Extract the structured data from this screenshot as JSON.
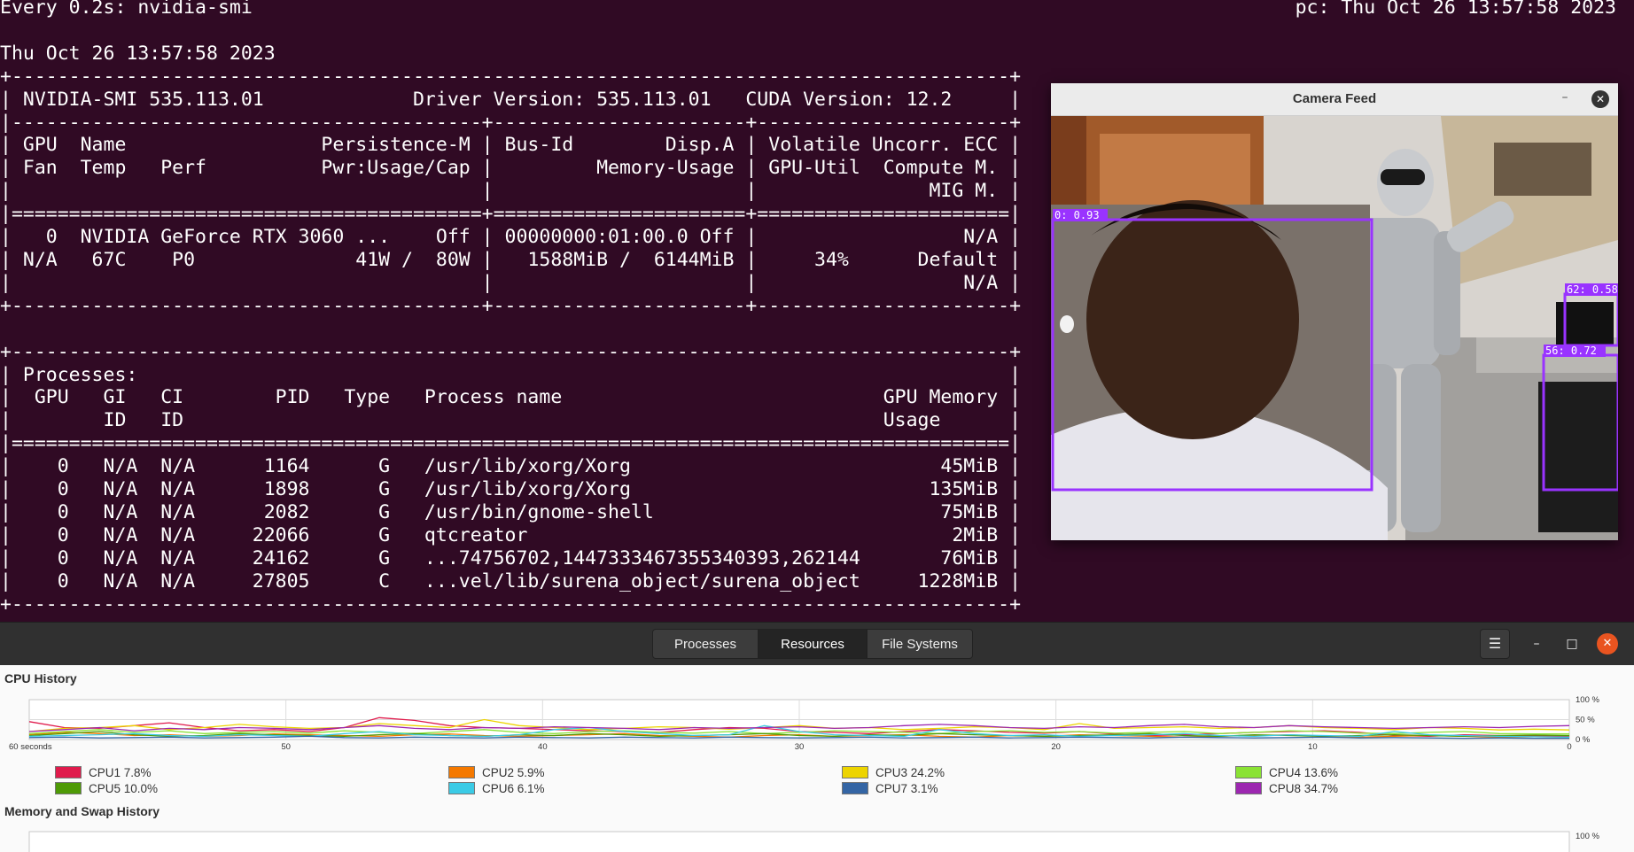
{
  "terminal": {
    "header_left": "Every 0.2s: nvidia-smi",
    "header_right": "pc: Thu Oct 26 13:57:58 2023",
    "lines": [
      "",
      "Thu Oct 26 13:57:58 2023",
      "+---------------------------------------------------------------------------------------+",
      "| NVIDIA-SMI 535.113.01             Driver Version: 535.113.01   CUDA Version: 12.2     |",
      "|-----------------------------------------+----------------------+----------------------+",
      "| GPU  Name                 Persistence-M | Bus-Id        Disp.A | Volatile Uncorr. ECC |",
      "| Fan  Temp   Perf          Pwr:Usage/Cap |         Memory-Usage | GPU-Util  Compute M. |",
      "|                                         |                      |               MIG M. |",
      "|=========================================+======================+======================|",
      "|   0  NVIDIA GeForce RTX 3060 ...    Off | 00000000:01:00.0 Off |                  N/A |",
      "| N/A   67C    P0              41W /  80W |   1588MiB /  6144MiB |     34%      Default |",
      "|                                         |                      |                  N/A |",
      "+-----------------------------------------+----------------------+----------------------+",
      "",
      "+---------------------------------------------------------------------------------------+",
      "| Processes:                                                                            |",
      "|  GPU   GI   CI        PID   Type   Process name                            GPU Memory |",
      "|        ID   ID                                                             Usage      |",
      "|=======================================================================================|",
      "|    0   N/A  N/A      1164      G   /usr/lib/xorg/Xorg                           45MiB |",
      "|    0   N/A  N/A      1898      G   /usr/lib/xorg/Xorg                          135MiB |",
      "|    0   N/A  N/A      2082      G   /usr/bin/gnome-shell                         75MiB |",
      "|    0   N/A  N/A     22066      G   qtcreator                                     2MiB |",
      "|    0   N/A  N/A     24162      G   ...74756702,1447333467355340393,262144       76MiB |",
      "|    0   N/A  N/A     27805      C   ...vel/lib/surena_object/surena_object     1228MiB |",
      "+---------------------------------------------------------------------------------------+"
    ]
  },
  "camera": {
    "title": "Camera Feed",
    "minimize_glyph": "–",
    "close_glyph": "✕",
    "detections": [
      "0: 0.93",
      "62: 0.58",
      "56: 0.72"
    ],
    "box_color": "#9933ff"
  },
  "sysmon": {
    "tabs": [
      "Processes",
      "Resources",
      "File Systems"
    ],
    "active_tab": "Resources",
    "menu_glyph": "☰",
    "min_glyph": "–",
    "max_glyph": "□",
    "close_glyph": "✕",
    "cpu_section_title": "CPU History",
    "memory_section_title": "Memory and Swap History",
    "memory_y_top_label": "100 %"
  },
  "chart_data": {
    "type": "line",
    "title": "CPU History",
    "x_tick_labels": [
      "60 seconds",
      "50",
      "40",
      "30",
      "20",
      "10",
      "0"
    ],
    "y_tick_labels": [
      "100 %",
      "50 %",
      "0 %"
    ],
    "xlim": [
      60,
      0
    ],
    "ylim": [
      0,
      100
    ],
    "grid": true,
    "legend_position": "bottom",
    "series": [
      {
        "name": "CPU1",
        "label": "CPU1  7.8%",
        "color": "#e01b4c",
        "values": [
          45,
          30,
          28,
          35,
          42,
          30,
          22,
          25,
          20,
          30,
          55,
          48,
          35,
          30,
          28,
          25,
          22,
          20,
          18,
          25,
          30,
          28,
          20,
          18,
          15,
          20,
          25,
          22,
          18,
          16,
          20,
          14,
          10,
          12,
          15,
          18,
          20,
          22,
          18,
          10,
          8,
          12,
          10,
          9,
          8
        ]
      },
      {
        "name": "CPU2",
        "label": "CPU2  5.9%",
        "color": "#f57900",
        "values": [
          12,
          18,
          15,
          10,
          12,
          8,
          10,
          14,
          12,
          10,
          8,
          12,
          14,
          10,
          8,
          10,
          12,
          15,
          10,
          8,
          6,
          10,
          12,
          8,
          10,
          12,
          8,
          6,
          10,
          8,
          12,
          10,
          8,
          6,
          8,
          10,
          12,
          8,
          6,
          8,
          10,
          8,
          6,
          7,
          6
        ]
      },
      {
        "name": "CPU3",
        "label": "CPU3  24.2%",
        "color": "#edd400",
        "values": [
          20,
          28,
          30,
          35,
          25,
          30,
          38,
          32,
          28,
          30,
          40,
          35,
          30,
          50,
          35,
          30,
          25,
          28,
          32,
          30,
          26,
          30,
          35,
          28,
          30,
          25,
          28,
          32,
          30,
          25,
          40,
          28,
          30,
          32,
          28,
          30,
          35,
          30,
          28,
          25,
          30,
          28,
          24,
          26,
          24
        ]
      },
      {
        "name": "CPU4",
        "label": "CPU4  13.6%",
        "color": "#8ae234",
        "values": [
          15,
          20,
          25,
          18,
          22,
          15,
          18,
          20,
          16,
          22,
          18,
          15,
          20,
          25,
          18,
          15,
          20,
          22,
          18,
          16,
          20,
          15,
          18,
          22,
          20,
          18,
          15,
          20,
          22,
          18,
          20,
          16,
          18,
          20,
          15,
          18,
          22,
          20,
          16,
          15,
          18,
          20,
          15,
          14,
          14
        ]
      },
      {
        "name": "CPU5",
        "label": "CPU5  10.0%",
        "color": "#4e9a06",
        "values": [
          10,
          15,
          20,
          12,
          8,
          10,
          15,
          12,
          10,
          8,
          12,
          15,
          10,
          8,
          12,
          10,
          15,
          12,
          8,
          10,
          12,
          15,
          10,
          8,
          12,
          10,
          15,
          12,
          10,
          8,
          10,
          12,
          15,
          10,
          8,
          12,
          10,
          8,
          10,
          12,
          10,
          8,
          10,
          11,
          10
        ]
      },
      {
        "name": "CPU6",
        "label": "CPU6  6.1%",
        "color": "#3bcbe6",
        "values": [
          8,
          10,
          12,
          15,
          10,
          8,
          12,
          10,
          8,
          15,
          20,
          12,
          10,
          8,
          12,
          25,
          30,
          20,
          15,
          10,
          12,
          35,
          20,
          12,
          10,
          8,
          25,
          15,
          10,
          12,
          8,
          10,
          12,
          15,
          10,
          8,
          12,
          10,
          8,
          20,
          12,
          10,
          8,
          7,
          6
        ]
      },
      {
        "name": "CPU7",
        "label": "CPU7  3.1%",
        "color": "#3465a4",
        "values": [
          5,
          6,
          4,
          5,
          6,
          4,
          5,
          6,
          8,
          5,
          4,
          6,
          5,
          4,
          6,
          5,
          4,
          6,
          5,
          4,
          6,
          5,
          4,
          5,
          6,
          4,
          5,
          6,
          4,
          5,
          6,
          5,
          4,
          6,
          5,
          4,
          5,
          6,
          4,
          5,
          4,
          3,
          4,
          3,
          3
        ]
      },
      {
        "name": "CPU8",
        "label": "CPU8  34.7%",
        "color": "#9c27b0",
        "values": [
          20,
          25,
          30,
          22,
          28,
          25,
          30,
          28,
          25,
          30,
          35,
          28,
          25,
          30,
          28,
          32,
          30,
          28,
          25,
          30,
          28,
          30,
          32,
          28,
          30,
          35,
          38,
          35,
          30,
          28,
          32,
          30,
          35,
          38,
          32,
          30,
          35,
          32,
          30,
          28,
          30,
          32,
          30,
          33,
          35
        ]
      }
    ]
  }
}
